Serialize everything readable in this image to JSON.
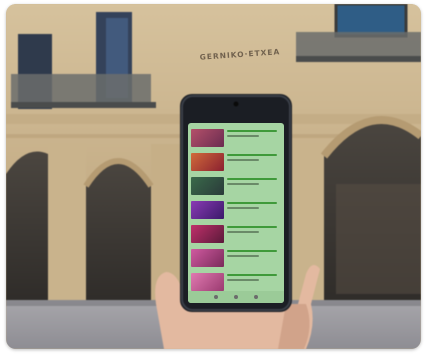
{
  "scene": {
    "sign_text": "GERNIKO·ETXEA",
    "phone_rows": 7,
    "colors": {
      "stone": "#cbb690",
      "stone_shadow": "#8c7654",
      "window": "#2f3a4c",
      "balcony": "#5a5d5c",
      "pavement": "#9b9aa0",
      "phone_body": "#1b1e24",
      "phone_screen": "#a6d5a3",
      "skin": "#e3b9a0"
    }
  }
}
